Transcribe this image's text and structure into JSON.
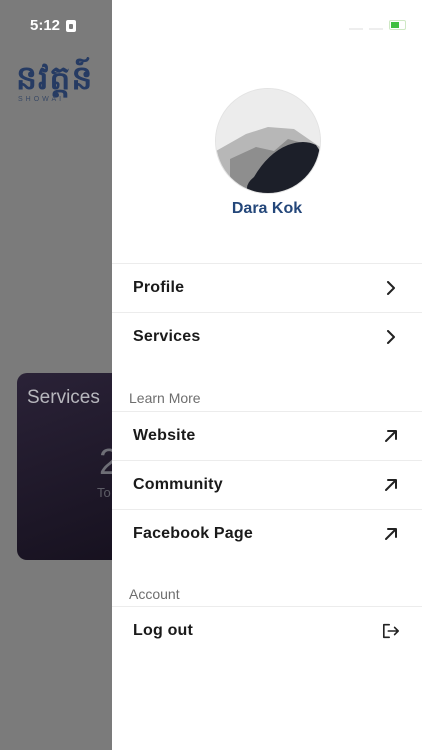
{
  "status_bar": {
    "time": "5:12"
  },
  "background": {
    "logo_text": "នវត្តន៍",
    "logo_sub": "SHOWAI",
    "card_title": "Services",
    "card_number": "2",
    "card_sub": "To"
  },
  "drawer": {
    "user_name": "Dara Kok",
    "items_main": [
      {
        "label": "Profile",
        "icon": "chevron-right-icon"
      },
      {
        "label": "Services",
        "icon": "chevron-right-icon"
      }
    ],
    "learn_more_label": "Learn More",
    "items_learn": [
      {
        "label": "Website",
        "icon": "external-link-icon"
      },
      {
        "label": "Community",
        "icon": "external-link-icon"
      },
      {
        "label": "Facebook Page",
        "icon": "external-link-icon"
      }
    ],
    "account_label": "Account",
    "logout_label": "Log out"
  },
  "colors": {
    "accent": "#24477a",
    "overlay": "#7b7b7b"
  }
}
